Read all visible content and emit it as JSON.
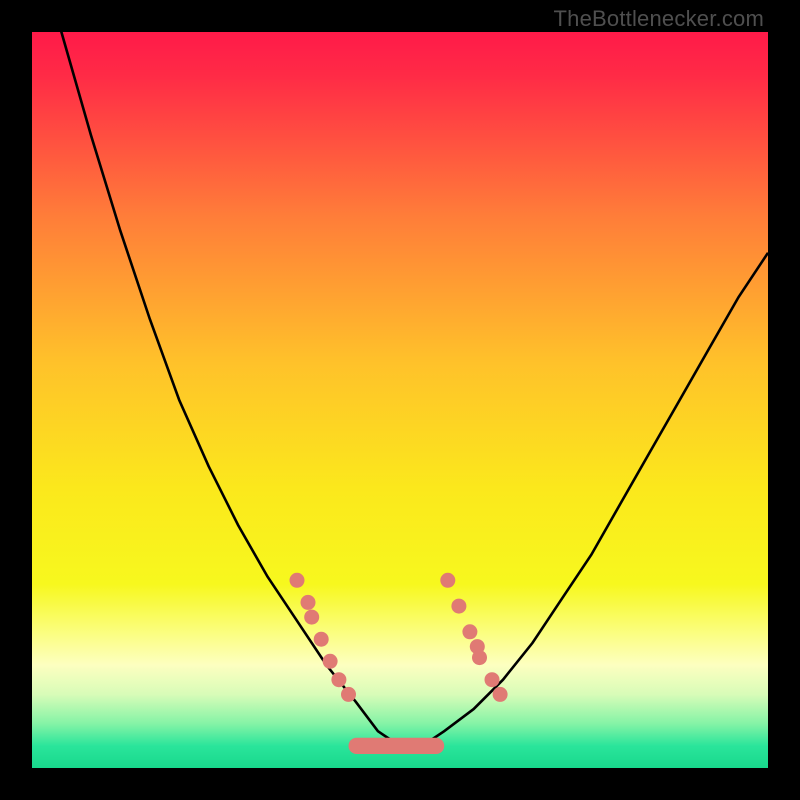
{
  "watermark": "TheBottlenecker.com",
  "chart_data": {
    "type": "line",
    "title": "",
    "xlabel": "",
    "ylabel": "",
    "xlim": [
      0,
      100
    ],
    "ylim": [
      0,
      100
    ],
    "background_gradient": [
      {
        "offset": 0.0,
        "color": "#ff1a49"
      },
      {
        "offset": 0.06,
        "color": "#ff2b46"
      },
      {
        "offset": 0.25,
        "color": "#ff7d39"
      },
      {
        "offset": 0.45,
        "color": "#ffc22a"
      },
      {
        "offset": 0.62,
        "color": "#fbe81c"
      },
      {
        "offset": 0.75,
        "color": "#f7f81e"
      },
      {
        "offset": 0.82,
        "color": "#fbfe85"
      },
      {
        "offset": 0.86,
        "color": "#fdffc0"
      },
      {
        "offset": 0.9,
        "color": "#d8fcb8"
      },
      {
        "offset": 0.94,
        "color": "#84f3a6"
      },
      {
        "offset": 0.97,
        "color": "#2ae59b"
      },
      {
        "offset": 1.0,
        "color": "#18d88c"
      }
    ],
    "curve": {
      "x": [
        0,
        4,
        8,
        12,
        16,
        20,
        24,
        28,
        32,
        36,
        40,
        44,
        47,
        50,
        53,
        56,
        60,
        64,
        68,
        72,
        76,
        80,
        84,
        88,
        92,
        96,
        100
      ],
      "y": [
        115,
        100,
        86,
        73,
        61,
        50,
        41,
        33,
        26,
        20,
        14,
        9,
        5,
        3,
        3,
        5,
        8,
        12,
        17,
        23,
        29,
        36,
        43,
        50,
        57,
        64,
        70
      ]
    },
    "scatter_points": [
      {
        "x": 36.0,
        "y": 25.5
      },
      {
        "x": 37.5,
        "y": 22.5
      },
      {
        "x": 38.0,
        "y": 20.5
      },
      {
        "x": 39.3,
        "y": 17.5
      },
      {
        "x": 40.5,
        "y": 14.5
      },
      {
        "x": 41.7,
        "y": 12.0
      },
      {
        "x": 43.0,
        "y": 10.0
      },
      {
        "x": 56.5,
        "y": 25.5
      },
      {
        "x": 58.0,
        "y": 22.0
      },
      {
        "x": 59.5,
        "y": 18.5
      },
      {
        "x": 60.5,
        "y": 16.5
      },
      {
        "x": 60.8,
        "y": 15.0
      },
      {
        "x": 62.5,
        "y": 12.0
      },
      {
        "x": 63.6,
        "y": 10.0
      }
    ],
    "valley_bar": {
      "x_start": 43.0,
      "x_end": 56.0,
      "y": 3.0,
      "thickness": 2.2
    },
    "marker_color": "#e07a74",
    "curve_color": "#000000"
  }
}
